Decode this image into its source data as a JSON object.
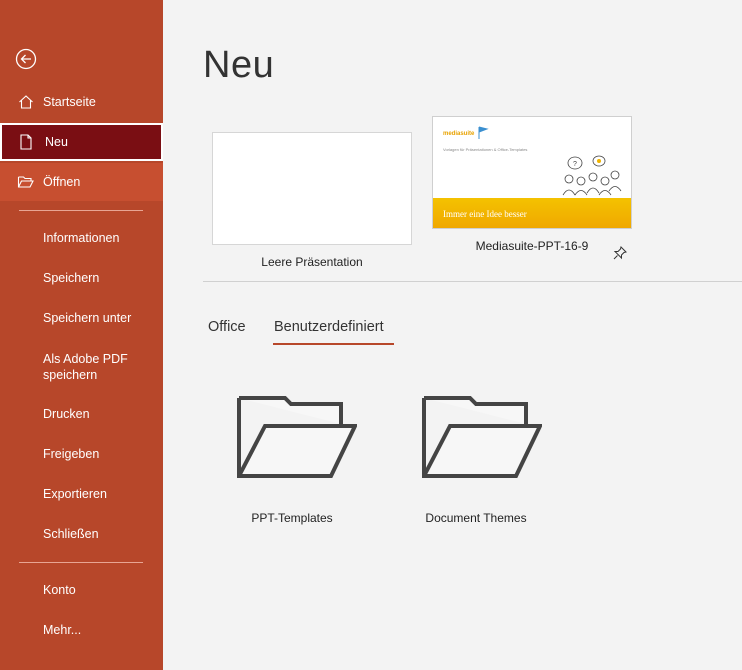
{
  "sidebar": {
    "items": [
      {
        "label": "Startseite"
      },
      {
        "label": "Neu"
      },
      {
        "label": "Öffnen"
      },
      {
        "label": "Informationen"
      },
      {
        "label": "Speichern"
      },
      {
        "label": "Speichern unter"
      },
      {
        "label": "Als Adobe PDF speichern"
      },
      {
        "label": "Drucken"
      },
      {
        "label": "Freigeben"
      },
      {
        "label": "Exportieren"
      },
      {
        "label": "Schließen"
      },
      {
        "label": "Konto"
      },
      {
        "label": "Mehr..."
      }
    ],
    "colors": {
      "background": "#b7472a",
      "active": "#7a0e13"
    }
  },
  "main": {
    "title": "Neu",
    "templates": [
      {
        "label": "Leere Präsentation"
      },
      {
        "label": "Mediasuite-PPT-16-9",
        "thumb_logo": "mediasuite",
        "thumb_subtitle": "Vorlagen für Präsentationen & Office-Templates",
        "thumb_banner": "Immer eine Idee besser"
      }
    ],
    "tabs": [
      {
        "label": "Office"
      },
      {
        "label": "Benutzerdefiniert",
        "active": true
      }
    ],
    "folders": [
      {
        "label": "PPT-Templates"
      },
      {
        "label": "Document Themes"
      }
    ],
    "accent": "#b7472a"
  }
}
